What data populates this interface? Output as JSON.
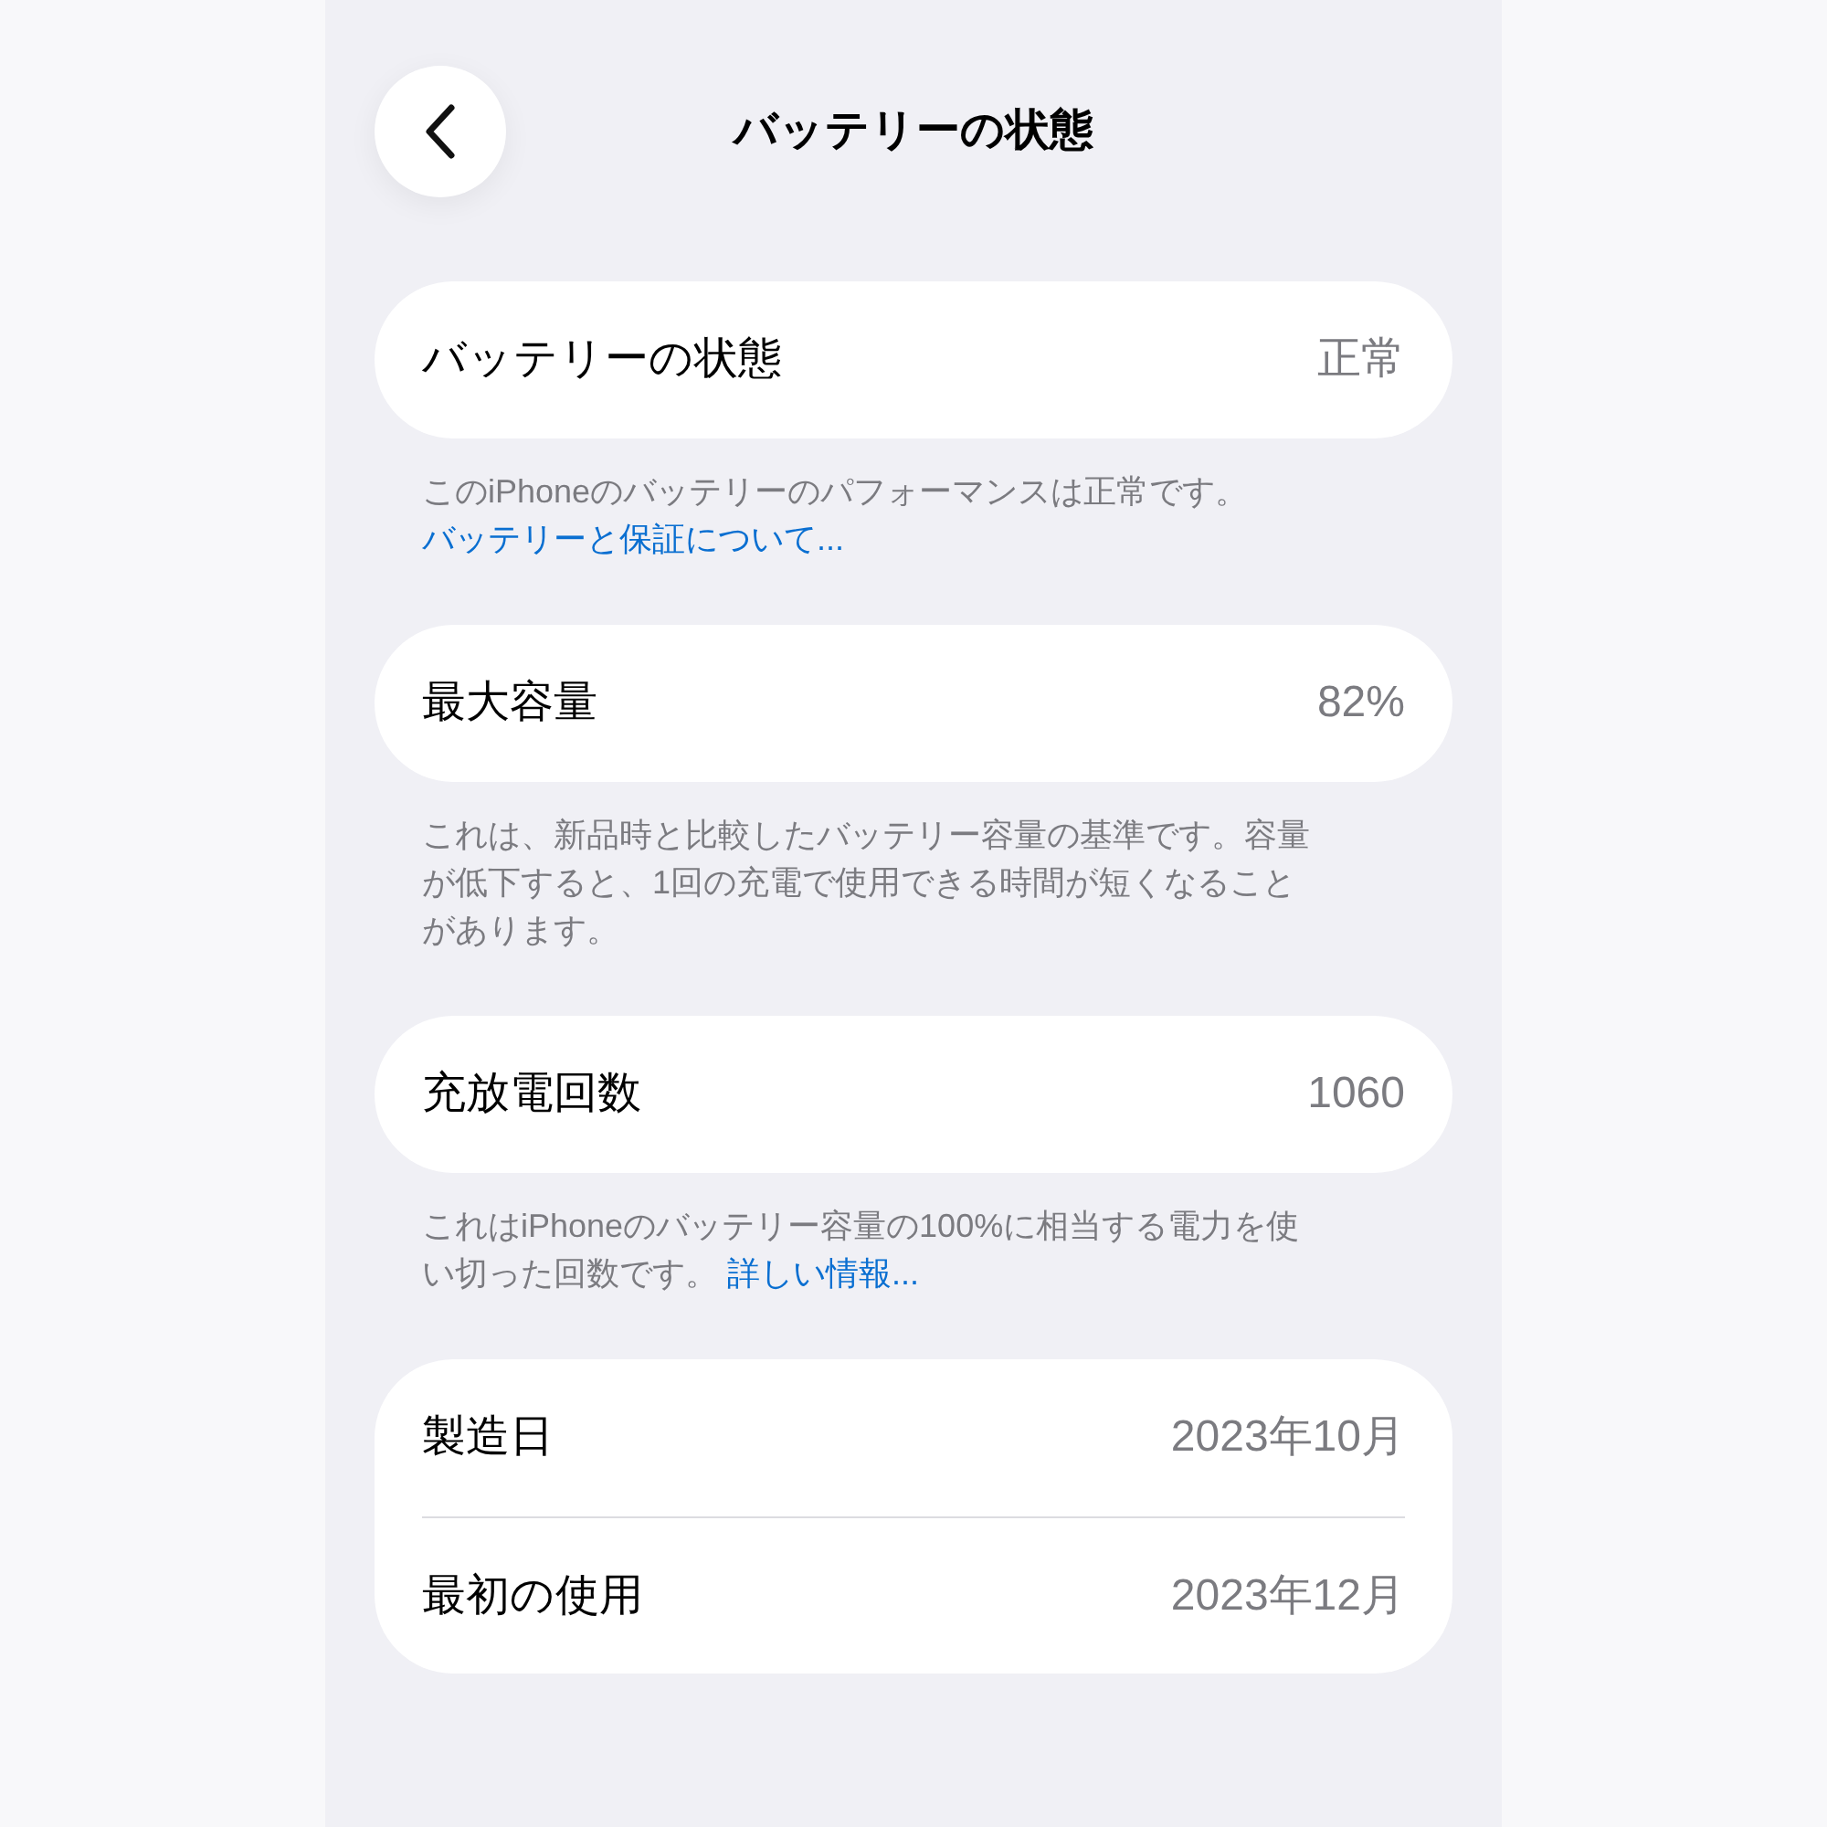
{
  "header": {
    "title": "バッテリーの状態"
  },
  "sections": [
    {
      "rows": [
        {
          "label": "バッテリーの状態",
          "value": "正常"
        }
      ],
      "footer": [
        {
          "kind": "text",
          "text": "このiPhoneのバッテリーのパフォーマンスは正常です。"
        },
        {
          "kind": "link",
          "text": "バッテリーと保証について..."
        }
      ]
    },
    {
      "rows": [
        {
          "label": "最大容量",
          "value": "82%"
        }
      ],
      "footer": [
        {
          "kind": "text",
          "text": "これは、新品時と比較したバッテリー容量の基準です。容量が低下すると、1回の充電で使用できる時間が短くなることがあります。"
        }
      ]
    },
    {
      "rows": [
        {
          "label": "充放電回数",
          "value": "1060"
        }
      ],
      "footer": [
        {
          "kind": "text",
          "text": "これはiPhoneのバッテリー容量の100%に相当する電力を使い切った回数です。"
        },
        {
          "kind": "link",
          "text": "詳しい情報..."
        }
      ]
    },
    {
      "rows": [
        {
          "label": "製造日",
          "value": "2023年10月"
        },
        {
          "label": "最初の使用",
          "value": "2023年12月"
        }
      ]
    }
  ]
}
